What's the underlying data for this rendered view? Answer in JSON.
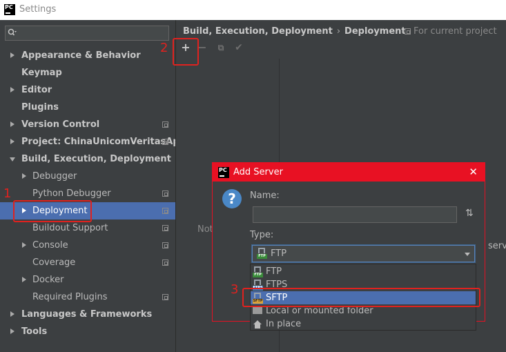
{
  "window": {
    "title": "Settings",
    "logo_text": "PC"
  },
  "search": {
    "placeholder": ""
  },
  "sidebar": {
    "items": [
      {
        "label": "Appearance & Behavior",
        "bold": true,
        "arrow": "right",
        "proj_icon": false
      },
      {
        "label": "Keymap",
        "bold": true,
        "arrow": "none",
        "proj_icon": false
      },
      {
        "label": "Editor",
        "bold": true,
        "arrow": "right",
        "proj_icon": false
      },
      {
        "label": "Plugins",
        "bold": true,
        "arrow": "none",
        "proj_icon": false
      },
      {
        "label": "Version Control",
        "bold": true,
        "arrow": "right",
        "proj_icon": true
      },
      {
        "label": "Project: ChinaUnicomVeritasApi",
        "bold": true,
        "arrow": "right",
        "proj_icon": true
      },
      {
        "label": "Build, Execution, Deployment",
        "bold": true,
        "arrow": "down",
        "proj_icon": false
      },
      {
        "label": "Debugger",
        "bold": false,
        "arrow": "right",
        "proj_icon": false
      },
      {
        "label": "Python Debugger",
        "bold": false,
        "arrow": "none",
        "proj_icon": true
      },
      {
        "label": "Deployment",
        "bold": false,
        "arrow": "right",
        "proj_icon": true,
        "selected": true
      },
      {
        "label": "Buildout Support",
        "bold": false,
        "arrow": "none",
        "proj_icon": true
      },
      {
        "label": "Console",
        "bold": false,
        "arrow": "right",
        "proj_icon": true
      },
      {
        "label": "Coverage",
        "bold": false,
        "arrow": "none",
        "proj_icon": true
      },
      {
        "label": "Docker",
        "bold": false,
        "arrow": "right",
        "proj_icon": false
      },
      {
        "label": "Required Plugins",
        "bold": false,
        "arrow": "none",
        "proj_icon": true
      },
      {
        "label": "Languages & Frameworks",
        "bold": true,
        "arrow": "right",
        "proj_icon": false
      },
      {
        "label": "Tools",
        "bold": true,
        "arrow": "right",
        "proj_icon": false
      }
    ]
  },
  "main": {
    "breadcrumb": {
      "parent": "Build, Execution, Deployment",
      "separator": "›",
      "current": "Deployment"
    },
    "for_project": "For current project",
    "toolbar": {
      "add": "+",
      "remove": "−",
      "copy": "⧉",
      "apply": "✔"
    },
    "nothing_text": "Not",
    "serve_text": "serve"
  },
  "dialog": {
    "logo_text": "PC",
    "title": "Add Server",
    "close": "✕",
    "question_icon": "?",
    "name_label": "Name:",
    "name_value": "",
    "sort_icon": "⇅",
    "type_label": "Type:",
    "type_value": "FTP",
    "options": [
      {
        "label": "FTP",
        "icon": "ftp-icon"
      },
      {
        "label": "FTPS",
        "icon": "ftps-icon"
      },
      {
        "label": "SFTP",
        "icon": "sftp-icon",
        "selected": true
      },
      {
        "label": "Local or mounted folder",
        "icon": "folder-icon"
      },
      {
        "label": "In place",
        "icon": "home-icon"
      }
    ]
  },
  "annotations": {
    "one": "1",
    "two": "2",
    "three": "3"
  },
  "colors": {
    "accent": "#4b6eaf",
    "dialog_border": "#e81123",
    "annotation": "#e0221f"
  }
}
